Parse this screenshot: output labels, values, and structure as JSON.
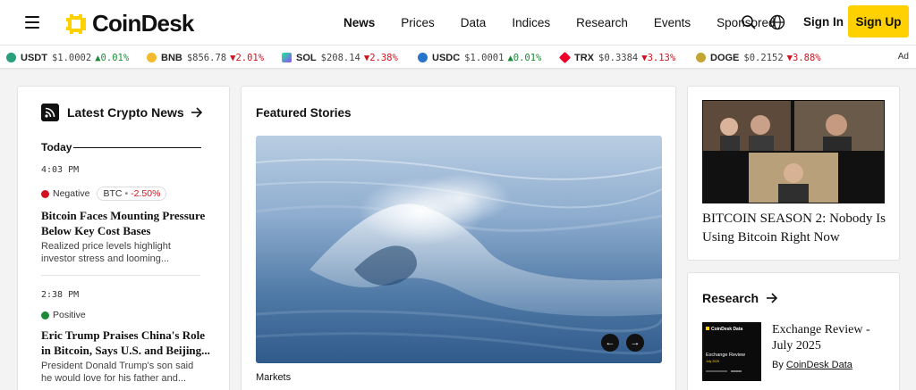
{
  "header": {
    "logo_text": "CoinDesk",
    "nav": [
      "News",
      "Prices",
      "Data",
      "Indices",
      "Research",
      "Events",
      "Sponsored"
    ],
    "active_nav": "News",
    "signin_label": "Sign In",
    "signup_label": "Sign Up",
    "accent_color": "#ffd100"
  },
  "ticker": {
    "items": [
      {
        "symbol": "USDT",
        "price": "$1.0002",
        "change": "0.01%",
        "direction": "up",
        "icon": "usdt-icon",
        "color": "#26a17b"
      },
      {
        "symbol": "BNB",
        "price": "$856.78",
        "change": "2.01%",
        "direction": "down",
        "icon": "bnb-icon",
        "color": "#f3ba2f"
      },
      {
        "symbol": "SOL",
        "price": "$208.14",
        "change": "2.38%",
        "direction": "down",
        "icon": "sol-icon",
        "color": "#9945ff"
      },
      {
        "symbol": "USDC",
        "price": "$1.0001",
        "change": "0.01%",
        "direction": "up",
        "icon": "usdc-icon",
        "color": "#2775ca"
      },
      {
        "symbol": "TRX",
        "price": "$0.3384",
        "change": "3.13%",
        "direction": "down",
        "icon": "trx-icon",
        "color": "#eb0029"
      },
      {
        "symbol": "DOGE",
        "price": "$0.2152",
        "change": "3.88%",
        "direction": "down",
        "icon": "doge-icon",
        "color": "#c2a633"
      }
    ],
    "ad_label": "Ad"
  },
  "latest_news": {
    "title": "Latest Crypto News",
    "section_label": "Today",
    "items": [
      {
        "time": "4:03 PM",
        "sentiment": "Negative",
        "asset": "BTC",
        "asset_change": "-2.50%",
        "headline": "Bitcoin Faces Mounting Pressure Below Key Cost Bases",
        "summary": "Realized price levels highlight investor stress and looming..."
      },
      {
        "time": "2:38 PM",
        "sentiment": "Positive",
        "headline": "Eric Trump Praises China's Role in Bitcoin, Says U.S. and Beijing...",
        "summary": "President Donald Trump's son said he would love for his father and..."
      }
    ]
  },
  "featured": {
    "title": "Featured Stories",
    "category": "Markets"
  },
  "video": {
    "title": "BITCOIN SEASON 2: Nobody Is Using Bitcoin Right Now"
  },
  "research": {
    "title": "Research",
    "thumb_brand": "CoinDesk Data",
    "thumb_title": "Exchange Review",
    "thumb_subtitle": "July 2025",
    "item_title": "Exchange Review - July 2025",
    "by_label": "By",
    "author": "CoinDesk Data"
  }
}
